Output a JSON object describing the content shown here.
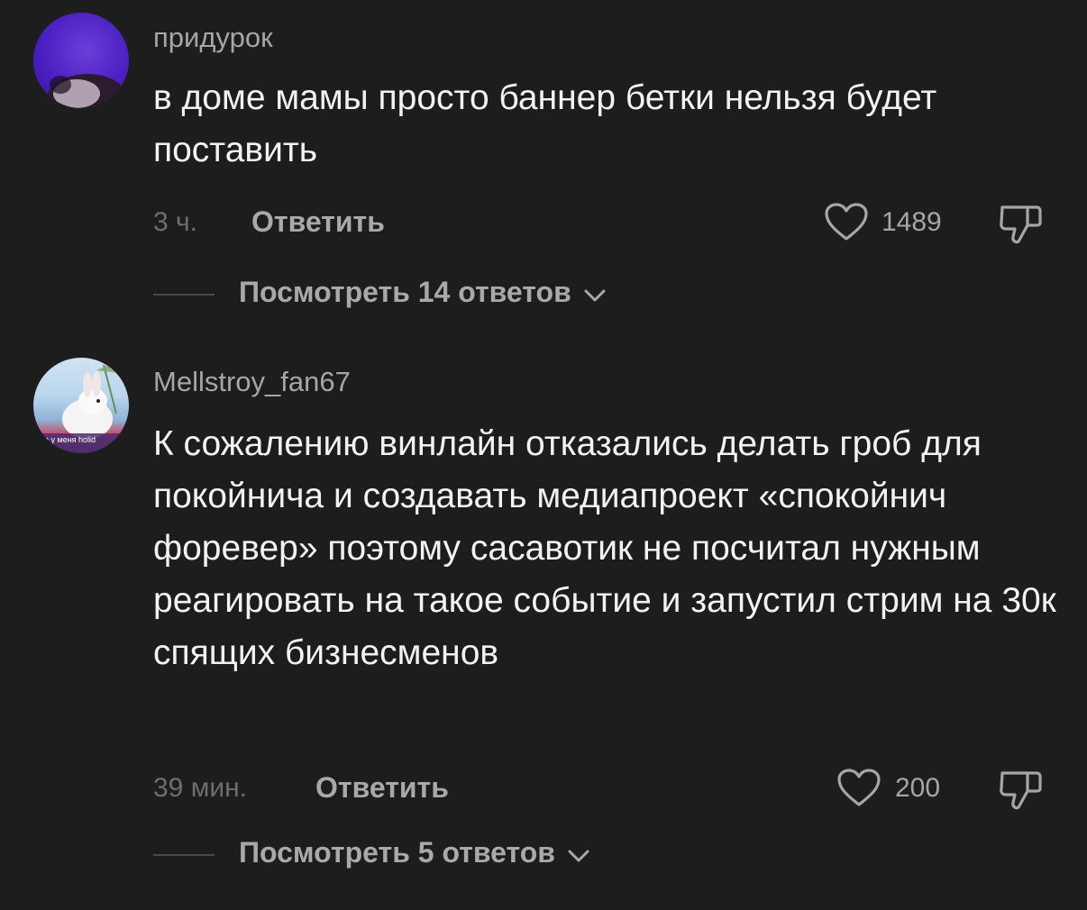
{
  "comments": [
    {
      "username": "придурок",
      "text": "в доме мамы просто баннер бетки нельзя будет поставить",
      "time": "3 ч.",
      "reply_label": "Ответить",
      "likes": "1489",
      "view_replies": "Посмотреть 14 ответов",
      "avatar_icon": "profile-photo-purple"
    },
    {
      "username": "Mellstroy_fan67",
      "text": "К сожалению винлайн отказались делать гроб для покойнича и создавать медиапроект «спокойнич форевер» поэтому сасавотик не посчитал нужным реагировать на такое событие и запустил стрим на 30к спящих бизнесменов",
      "time": "39 мин.",
      "reply_label": "Ответить",
      "likes": "200",
      "view_replies": "Посмотреть 5 ответов",
      "avatar_icon": "profile-photo-bunny",
      "avatar_caption": "ьте у меня holid"
    }
  ],
  "colors": {
    "background": "#1d1d1d",
    "username": "#a6a6a6",
    "text": "#f2f2f2",
    "muted": "#6e6e6e",
    "action": "#a9a9a9"
  }
}
